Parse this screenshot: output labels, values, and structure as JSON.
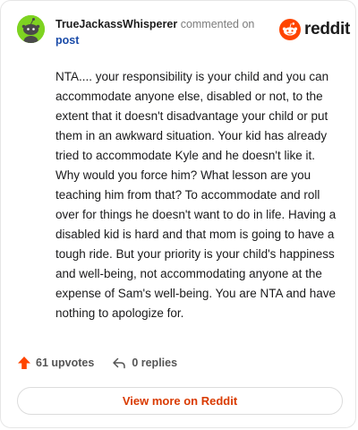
{
  "header": {
    "username": "TrueJackassWhisperer",
    "commented_text": "commented on",
    "post_link": "post",
    "logo_text": "reddit"
  },
  "comment": {
    "body": "NTA.... your responsibility is your child and you can accommodate anyone else, disabled or not, to the extent that it doesn't disadvantage your child or put them in an awkward situation. Your kid has already tried to accommodate Kyle and he doesn't like it. Why would you force him? What lesson are you teaching him from that? To accommodate and roll over for things he doesn't want to do in life. Having a disabled kid is hard and that mom is going to have a tough ride. But your priority is your child's happiness and well-being, not accommodating anyone at the expense of Sam's well-being. You are NTA and have nothing to apologize for."
  },
  "actions": {
    "upvotes_label": "61 upvotes",
    "replies_label": "0 replies"
  },
  "footer": {
    "view_more_label": "View more on Reddit"
  },
  "colors": {
    "accent": "#ff4500",
    "avatar_bg": "#7ed321",
    "link": "#1a4ba8",
    "view_more": "#d93a00"
  },
  "icons": {
    "avatar": "snoo-avatar-icon",
    "logo": "reddit-logo-icon",
    "upvote": "upvote-arrow-icon",
    "reply": "reply-arrow-icon"
  }
}
